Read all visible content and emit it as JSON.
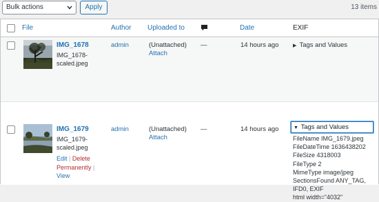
{
  "toolbar": {
    "bulk_actions_value": "Bulk actions",
    "apply_label": "Apply",
    "items_count": "13 items"
  },
  "columns": {
    "file": "File",
    "author": "Author",
    "uploaded_to": "Uploaded to",
    "comments_icon": "comment-bubble-icon",
    "date": "Date",
    "exif": "EXIF"
  },
  "rows": [
    {
      "title": "IMG_1678",
      "filename": "IMG_1678-scaled.jpeg",
      "author": "admin",
      "uploaded_to": "(Unattached)",
      "attach_label": "Attach",
      "comments": "—",
      "date": "14 hours ago",
      "exif_toggle": "Tags and Values",
      "exif_expanded": false
    },
    {
      "title": "IMG_1679",
      "filename": "IMG_1679-scaled.jpeg",
      "author": "admin",
      "uploaded_to": "(Unattached)",
      "attach_label": "Attach",
      "comments": "—",
      "date": "14 hours ago",
      "exif_toggle": "Tags and Values",
      "exif_expanded": true,
      "actions": {
        "edit": "Edit",
        "delete": "Delete Permanently",
        "view": "View"
      },
      "exif_lines": [
        "FileName IMG_1679.jpeg",
        "FileDateTime 1636438202",
        "FileSize 4318003",
        "FileType 2",
        "MimeType image/jpeg",
        "SectionsFound ANY_TAG,",
        "IFD0, EXIF",
        "html width=\"4032\""
      ]
    }
  ],
  "colors": {
    "link": "#2271b1",
    "delete": "#b32d2e",
    "row_alt_bg": "#f6f7f7",
    "border": "#c3c4c7"
  }
}
